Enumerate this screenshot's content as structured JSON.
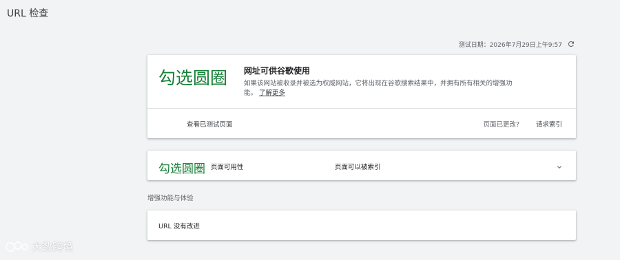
{
  "header": {
    "title": "URL 检查"
  },
  "test_info": {
    "date_text": "测试日期：2026年7月29日上午9:57",
    "refresh_icon": "refresh-icon"
  },
  "verdict_card": {
    "mark": "勾选圆圈",
    "title": "网址可供谷歌使用",
    "description": "如果该网站被收录并被选为权威网站，它将出现在谷歌搜索结果中，并拥有所有相关的增强功能。",
    "learn_more": "了解更多",
    "view_tested_page": "查看已测试页面",
    "page_changed": "页面已更改?",
    "request_indexing": "请求索引"
  },
  "availability_card": {
    "mark": "勾选圆圈",
    "label": "页面可用性",
    "value": "页面可以被索引",
    "expand_icon": "chevron-down-icon"
  },
  "enhancements": {
    "heading": "增强功能与体验",
    "item_label": "URL 没有改进"
  },
  "watermark": {
    "text": "大数跨境"
  },
  "colors": {
    "background": "#f1f3f4",
    "card": "#ffffff",
    "success_green": "#188038",
    "secondary_text": "#5f6368"
  }
}
